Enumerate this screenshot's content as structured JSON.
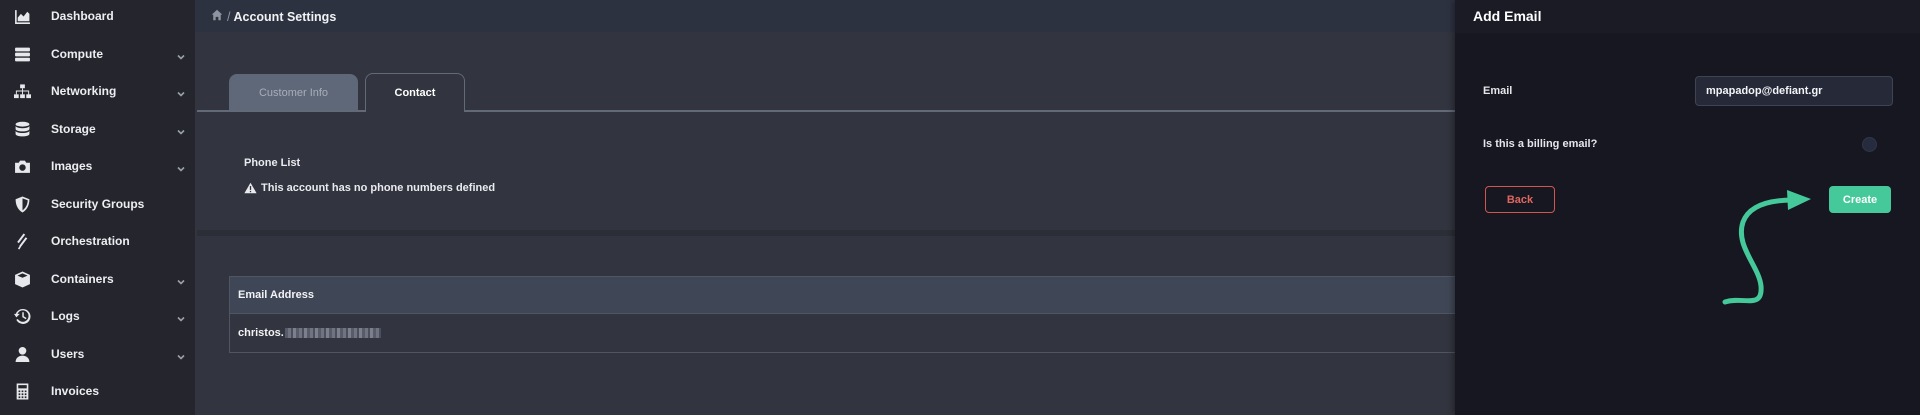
{
  "sidebar": {
    "items": [
      {
        "label": "Dashboard",
        "icon": "chart-area-icon",
        "chevron": false
      },
      {
        "label": "Compute",
        "icon": "server-icon",
        "chevron": true
      },
      {
        "label": "Networking",
        "icon": "sitemap-icon",
        "chevron": true
      },
      {
        "label": "Storage",
        "icon": "database-icon",
        "chevron": true
      },
      {
        "label": "Images",
        "icon": "camera-icon",
        "chevron": true
      },
      {
        "label": "Security Groups",
        "icon": "shield-icon",
        "chevron": false
      },
      {
        "label": "Orchestration",
        "icon": "orchestration-icon",
        "chevron": false
      },
      {
        "label": "Containers",
        "icon": "cube-icon",
        "chevron": true
      },
      {
        "label": "Logs",
        "icon": "history-icon",
        "chevron": true
      },
      {
        "label": "Users",
        "icon": "user-icon",
        "chevron": true
      },
      {
        "label": "Invoices",
        "icon": "calculator-icon",
        "chevron": false
      }
    ]
  },
  "header": {
    "breadcrumb_sep": "/",
    "title": "Account Settings"
  },
  "tabs": [
    {
      "label": "Customer Info",
      "active": false
    },
    {
      "label": "Contact",
      "active": true
    }
  ],
  "phone": {
    "title": "Phone List",
    "warning": "This account has no phone numbers defined"
  },
  "emails": {
    "column": "Email Address",
    "rows": [
      {
        "email_visible": "christos."
      }
    ]
  },
  "drawer": {
    "title": "Add Email",
    "email_label": "Email",
    "email_value": "mpapadop@defiant.gr",
    "billing_label": "Is this a billing email?",
    "billing_checked": false,
    "back_label": "Back",
    "create_label": "Create"
  },
  "colors": {
    "accent": "#45c99a",
    "danger": "#e06660",
    "sidebar_bg": "#25262d",
    "content_bg": "#32343f",
    "drawer_bg": "#161720"
  }
}
